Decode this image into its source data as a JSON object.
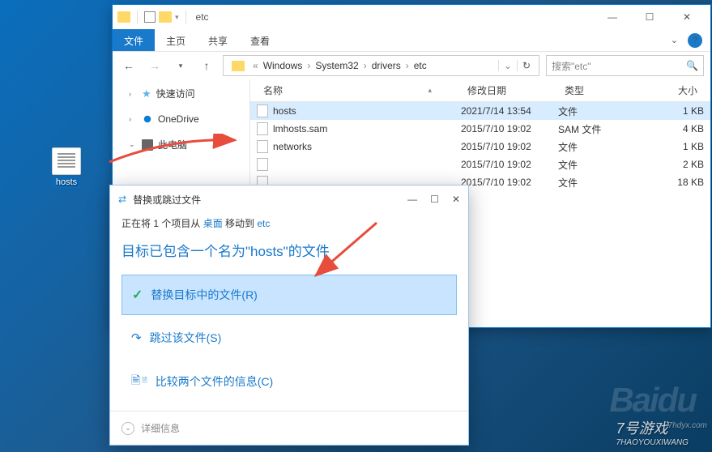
{
  "desktop": {
    "icon_label": "hosts"
  },
  "explorer": {
    "title": "etc",
    "tabs": {
      "file": "文件",
      "home": "主页",
      "share": "共享",
      "view": "查看"
    },
    "path": {
      "crumbs": [
        "Windows",
        "System32",
        "drivers",
        "etc"
      ]
    },
    "search_placeholder": "搜索\"etc\"",
    "cols": {
      "name": "名称",
      "date": "修改日期",
      "type": "类型",
      "size": "大小"
    },
    "sidebar": {
      "quick": "快速访问",
      "onedrive": "OneDrive",
      "pc": "此电脑"
    },
    "files": [
      {
        "name": "hosts",
        "date": "2021/7/14 13:54",
        "type": "文件",
        "size": "1 KB",
        "sel": true
      },
      {
        "name": "lmhosts.sam",
        "date": "2015/7/10 19:02",
        "type": "SAM 文件",
        "size": "4 KB"
      },
      {
        "name": "networks",
        "date": "2015/7/10 19:02",
        "type": "文件",
        "size": "1 KB"
      },
      {
        "name": "",
        "date": "2015/7/10 19:02",
        "type": "文件",
        "size": "2 KB"
      },
      {
        "name": "",
        "date": "2015/7/10 19:02",
        "type": "文件",
        "size": "18 KB"
      }
    ]
  },
  "dialog": {
    "title": "替换或跳过文件",
    "subtitle_pre": "正在将 1 个项目从 ",
    "subtitle_from": "桌面",
    "subtitle_mid": " 移动到 ",
    "subtitle_to": "etc",
    "heading": "目标已包含一个名为\"hosts\"的文件",
    "opt_replace": "替换目标中的文件(R)",
    "opt_skip": "跳过该文件(S)",
    "opt_compare": "比较两个文件的信息(C)",
    "details": "详细信息"
  },
  "watermark": {
    "main": "7号游戏",
    "sub": "7HAOYOUXIWANG",
    "url": "7hdyx.com",
    "bg": "Baidu"
  }
}
